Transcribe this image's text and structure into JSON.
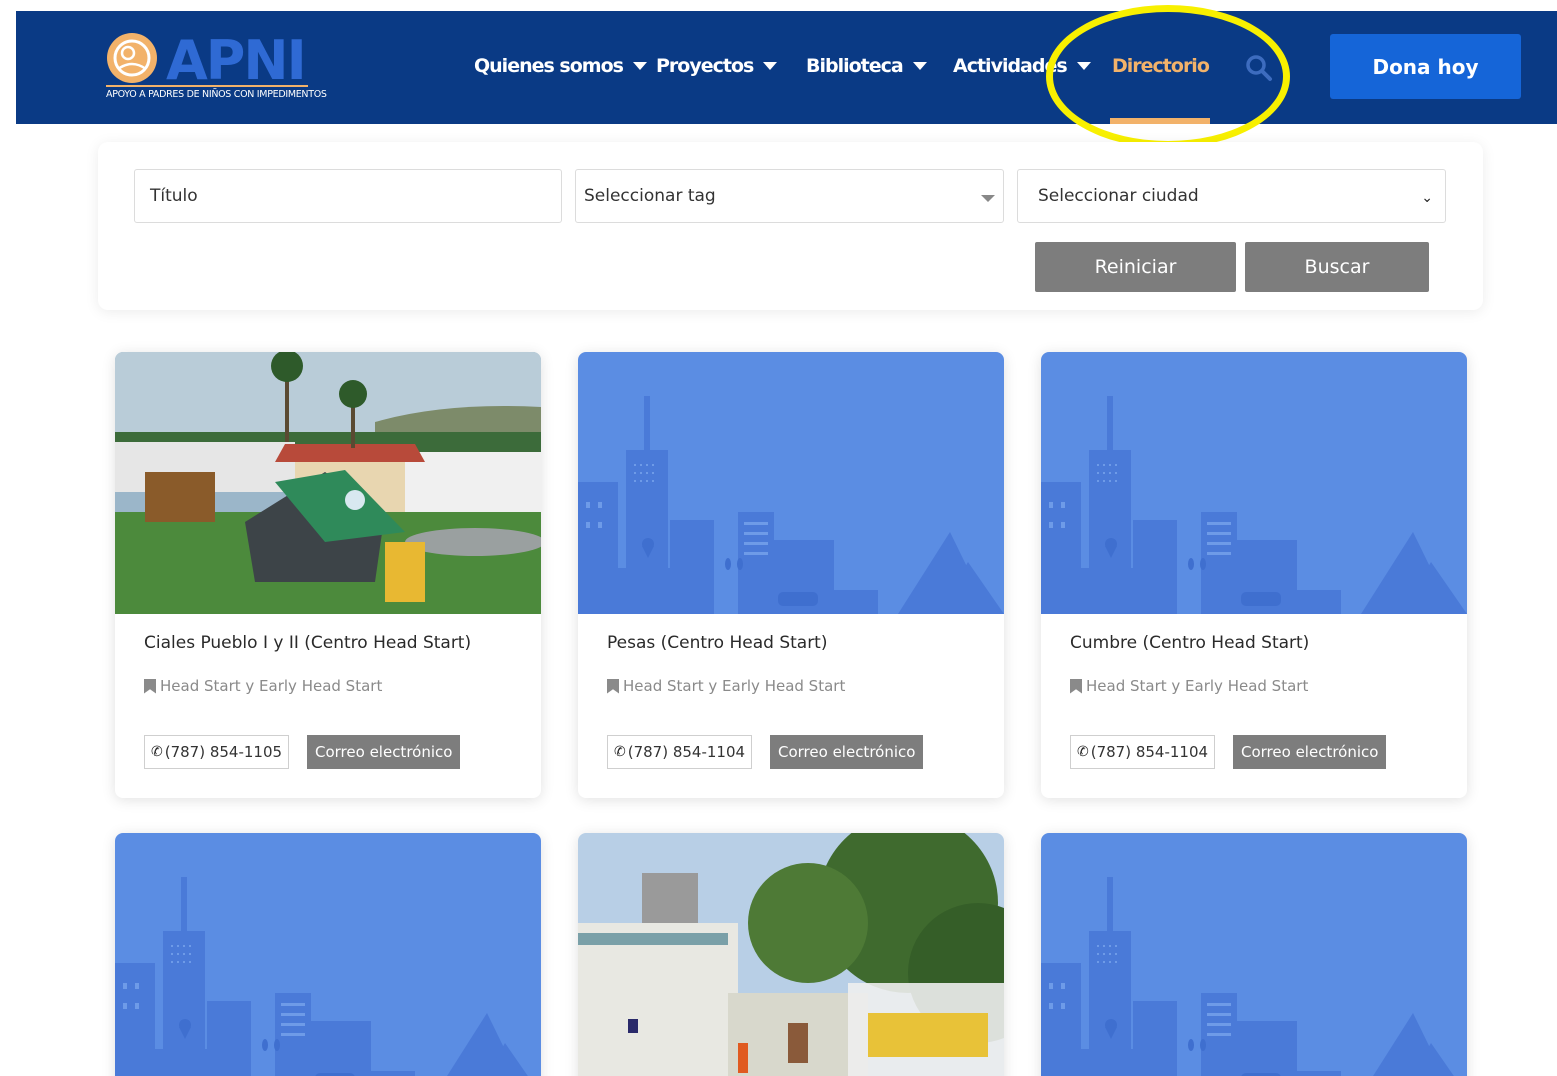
{
  "header": {
    "logo": {
      "name": "APNI",
      "tagline": "APOYO A PADRES DE NIÑOS CON IMPEDIMENTOS"
    },
    "nav": [
      {
        "label": "Quienes somos",
        "dropdown": true
      },
      {
        "label": "Proyectos",
        "dropdown": true
      },
      {
        "label": "Biblioteca",
        "dropdown": true
      },
      {
        "label": "Actividades",
        "dropdown": true
      },
      {
        "label": "Directorio",
        "dropdown": false,
        "active": true
      }
    ],
    "donate_label": "Dona hoy"
  },
  "filters": {
    "title_placeholder": "Título",
    "tag_selected": "Seleccionar tag",
    "city_selected": "Seleccionar ciudad",
    "reset_label": "Reiniciar",
    "search_label": "Buscar"
  },
  "cards": [
    {
      "title": "Ciales Pueblo I y II (Centro Head Start)",
      "tag": "Head Start y Early Head Start",
      "phone": "(787) 854-1105",
      "email_label": "Correo electrónico",
      "image": "photo-playground"
    },
    {
      "title": "Pesas (Centro Head Start)",
      "tag": "Head Start y Early Head Start",
      "phone": "(787) 854-1104",
      "email_label": "Correo electrónico",
      "image": "placeholder-city"
    },
    {
      "title": "Cumbre (Centro Head Start)",
      "tag": "Head Start y Early Head Start",
      "phone": "(787) 854-1104",
      "email_label": "Correo electrónico",
      "image": "placeholder-city"
    },
    {
      "image": "placeholder-city"
    },
    {
      "image": "photo-building"
    },
    {
      "image": "placeholder-city"
    }
  ],
  "colors": {
    "header_bg": "#0a3a85",
    "accent_orange": "#f2b26a",
    "donate_blue": "#1565d8",
    "placeholder_blue": "#5b8de3",
    "button_gray": "#7d7d7d",
    "highlight_yellow": "#f8f000"
  }
}
